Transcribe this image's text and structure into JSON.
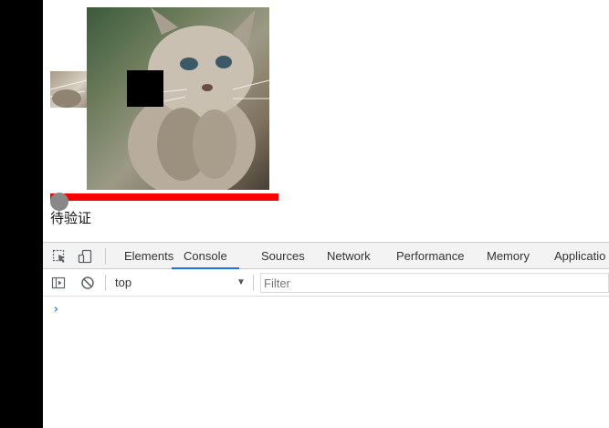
{
  "captcha": {
    "status_text": "待验证",
    "slider_color": "#ff0000",
    "handle_color": "#888888"
  },
  "devtools": {
    "tabs": [
      {
        "label": "Elements",
        "active": false
      },
      {
        "label": "Console",
        "active": true
      },
      {
        "label": "Sources",
        "active": false
      },
      {
        "label": "Network",
        "active": false
      },
      {
        "label": "Performance",
        "active": false
      },
      {
        "label": "Memory",
        "active": false
      },
      {
        "label": "Applicatio",
        "active": false
      }
    ],
    "context": "top",
    "filter_placeholder": "Filter",
    "prompt_symbol": "›",
    "accent": "#1a73e8"
  }
}
